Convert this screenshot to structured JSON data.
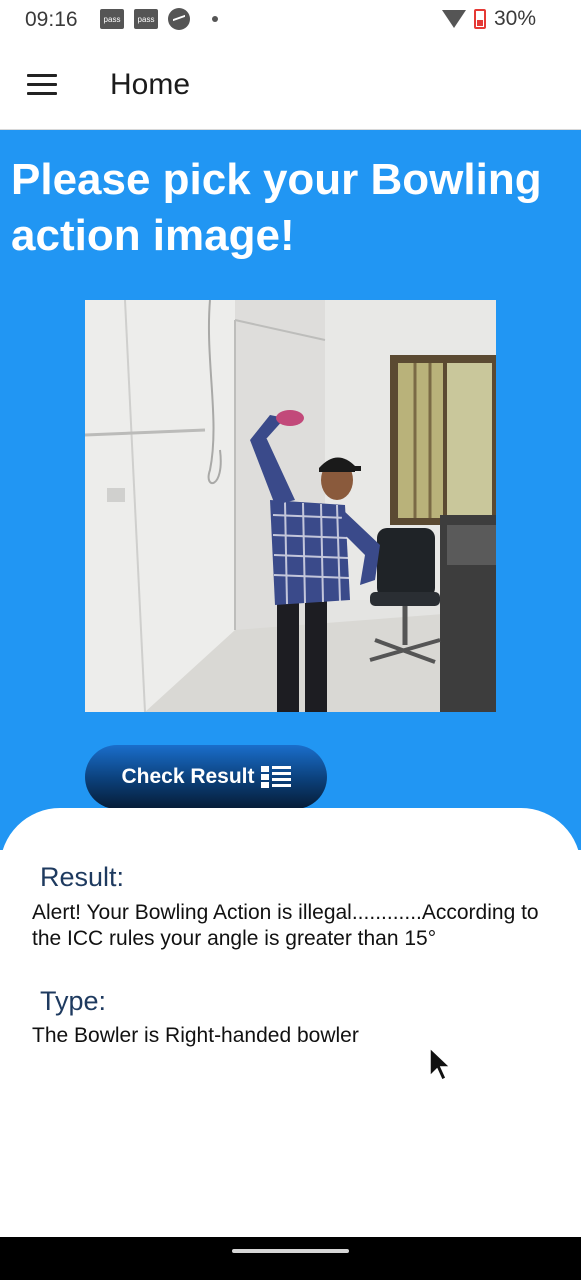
{
  "status_bar": {
    "time": "09:16",
    "pass_label": "pass",
    "battery": "30%",
    "icons": [
      "pass-icon",
      "pass-icon",
      "messenger-icon",
      "dot-icon",
      "wifi-icon",
      "battery-icon"
    ]
  },
  "app_bar": {
    "title": "Home",
    "menu_icon": "hamburger-menu-icon"
  },
  "main": {
    "headline": "Please pick your Bowling action image!",
    "background_color": "#2196f3",
    "check_button_label": "Check Result",
    "check_button_icon": "list-icon"
  },
  "result": {
    "result_label": "Result:",
    "result_text": "Alert! Your Bowling Action is illegal............According to the ICC rules your angle is greater than 15°",
    "type_label": "Type:",
    "type_text": "The Bowler is Right-handed bowler"
  }
}
